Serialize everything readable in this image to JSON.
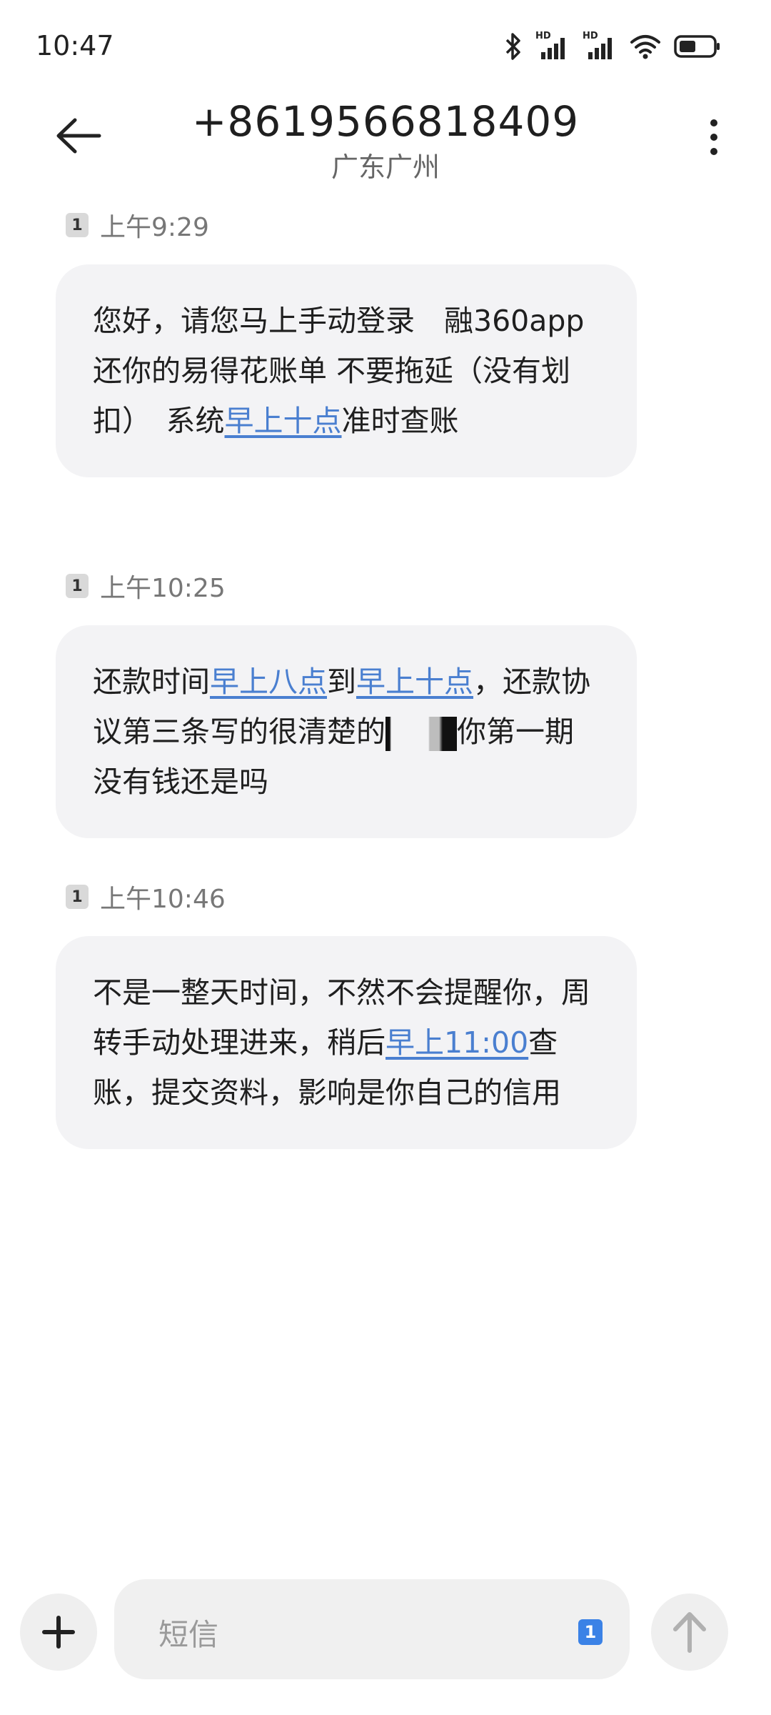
{
  "status_bar": {
    "time": "10:47",
    "icons": [
      "bluetooth-icon",
      "hd-signal-icon",
      "hd-signal-icon",
      "wifi-icon",
      "battery-icon"
    ],
    "hd_label": "HD"
  },
  "header": {
    "title": "+8619566818409",
    "subtitle": "广东广州",
    "back_icon": "arrow-left-icon",
    "more_icon": "more-vertical-icon"
  },
  "messages": [
    {
      "sim": "1",
      "time": "上午9:29",
      "parts": [
        {
          "text": "您好，请您马上手动登录　融360app还你的易得花账单 不要拖延（没有划扣）　系统"
        },
        {
          "text": "早上十点",
          "link": true
        },
        {
          "text": "准时查账"
        }
      ]
    },
    {
      "sim": "1",
      "time": "上午10:25",
      "parts": [
        {
          "text": "还款时间"
        },
        {
          "text": "早上八点",
          "link": true
        },
        {
          "text": "到"
        },
        {
          "text": "早上十点",
          "link": true
        },
        {
          "text": "，还款协议第三条写的很清楚的"
        },
        {
          "text": "你第一期没有钱还是吗"
        }
      ]
    },
    {
      "sim": "1",
      "time": "上午10:46",
      "parts": [
        {
          "text": "不是一整天时间，不然不会提醒你，周转手动处理进来，稍后"
        },
        {
          "text": "早上11:00",
          "link": true
        },
        {
          "text": "查账，提交资料，影响是你自己的信用"
        }
      ]
    }
  ],
  "composer": {
    "placeholder": "短信",
    "sim": "1",
    "add_icon": "plus-icon",
    "send_icon": "arrow-up-icon"
  },
  "colors": {
    "link": "#4a7fd0",
    "bubble": "#f3f3f5",
    "sim_select": "#3b82e6"
  }
}
